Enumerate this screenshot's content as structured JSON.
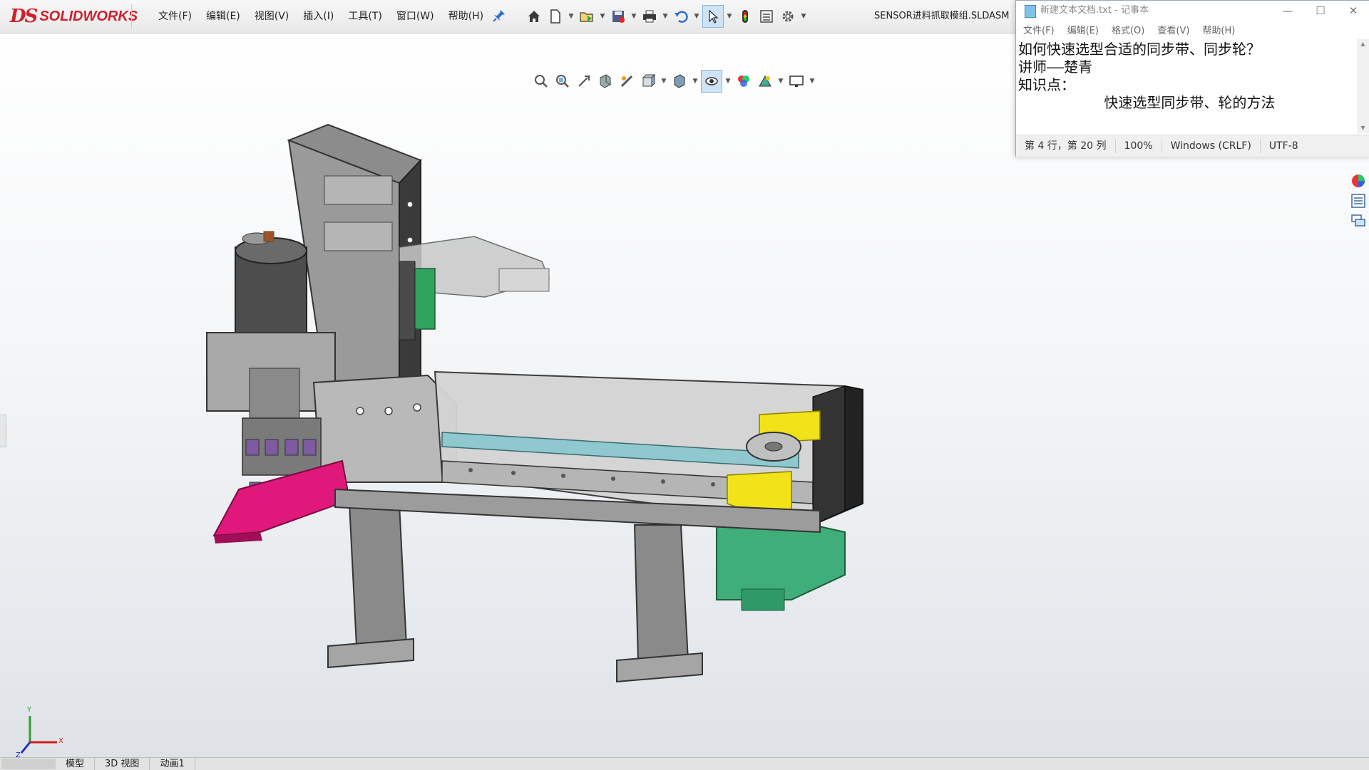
{
  "solidworks": {
    "logo": {
      "ds": "DS",
      "word": "SOLIDWORKS"
    },
    "menu": [
      "文件(F)",
      "编辑(E)",
      "视图(V)",
      "插入(I)",
      "工具(T)",
      "窗口(W)",
      "帮助(H)"
    ],
    "document_title": "SENSOR进料抓取模组.SLDASM",
    "toolbar_icons": [
      "home-icon",
      "new-document-icon",
      "open-icon",
      "save-icon",
      "print-icon",
      "undo-icon",
      "select-icon",
      "rebuild-icon",
      "file-properties-icon",
      "options-icon"
    ],
    "view_toolbar_icons": [
      "zoom-to-fit-icon",
      "zoom-to-area-icon",
      "previous-view-icon",
      "section-view-icon",
      "dynamic-annotation-icon",
      "view-orientation-icon",
      "display-style-icon",
      "hide-show-icon",
      "edit-appearance-icon",
      "apply-scene-icon",
      "view-settings-icon"
    ],
    "bottom_tabs": [
      "模型",
      "3D 视图",
      "动画1"
    ],
    "triad": {
      "x": "X",
      "y": "Y",
      "z": "Z"
    }
  },
  "notepad": {
    "title": "新建文本文档.txt - 记事本",
    "menu": [
      "文件(F)",
      "编辑(E)",
      "格式(O)",
      "查看(V)",
      "帮助(H)"
    ],
    "lines": [
      "如何快速选型合适的同步带、同步轮？",
      "讲师——楚青",
      "知识点：",
      "          快速选型同步带、轮的方法"
    ],
    "status": {
      "position": "第 4 行，第 20 列",
      "zoom": "100%",
      "line_ending": "Windows (CRLF)",
      "encoding": "UTF-8"
    }
  },
  "colors": {
    "accent_pink": "#e0187c",
    "accent_yellow": "#f2e21a",
    "accent_green": "#3fae7a",
    "logo_red": "#d0202a"
  }
}
